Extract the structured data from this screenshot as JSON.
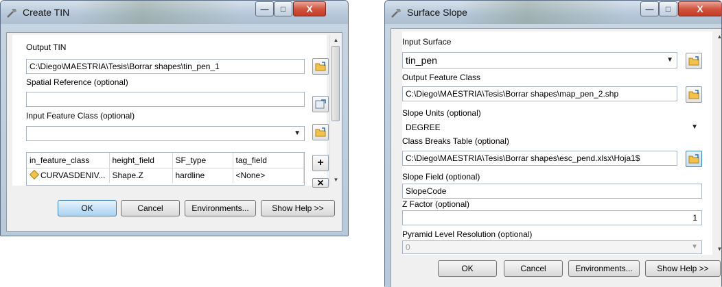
{
  "create_tin": {
    "title": "Create TIN",
    "output_tin": {
      "label": "Output TIN",
      "value": "C:\\Diego\\MAESTRIA\\Tesis\\Borrar shapes\\tin_pen_1"
    },
    "spatial_reference": {
      "label": "Spatial Reference (optional)",
      "value": ""
    },
    "input_feature_class": {
      "label": "Input Feature Class (optional)",
      "value": ""
    },
    "table": {
      "columns": [
        "in_feature_class",
        "height_field",
        "SF_type",
        "tag_field"
      ],
      "rows": [
        {
          "in_feature_class": "CURVASDENIV...",
          "height_field": "Shape.Z",
          "SF_type": "hardline",
          "tag_field": "<None>"
        }
      ]
    },
    "add_glyph": "+",
    "remove_glyph": "×",
    "buttons": {
      "ok": "OK",
      "cancel": "Cancel",
      "environments": "Environments...",
      "show_help": "Show Help >>"
    }
  },
  "surface_slope": {
    "title": "Surface Slope",
    "input_surface": {
      "label": "Input Surface",
      "value": "tin_pen"
    },
    "output_feature_class": {
      "label": "Output Feature Class",
      "value": "C:\\Diego\\MAESTRIA\\Tesis\\Borrar shapes\\map_pen_2.shp"
    },
    "slope_units": {
      "label": "Slope Units (optional)",
      "value": "DEGREE"
    },
    "class_breaks_table": {
      "label": "Class Breaks Table (optional)",
      "value": "C:\\Diego\\MAESTRIA\\Tesis\\Borrar shapes\\esc_pend.xlsx\\Hoja1$"
    },
    "slope_field": {
      "label": "Slope Field (optional)",
      "value": "SlopeCode"
    },
    "z_factor": {
      "label": "Z Factor (optional)",
      "value": "1"
    },
    "pyramid_level": {
      "label": "Pyramid Level Resolution (optional)",
      "value": "0"
    },
    "buttons": {
      "ok": "OK",
      "cancel": "Cancel",
      "environments": "Environments...",
      "show_help": "Show Help >>"
    }
  },
  "window_controls": {
    "minimize": "—",
    "maximize": "□",
    "close": "X"
  }
}
